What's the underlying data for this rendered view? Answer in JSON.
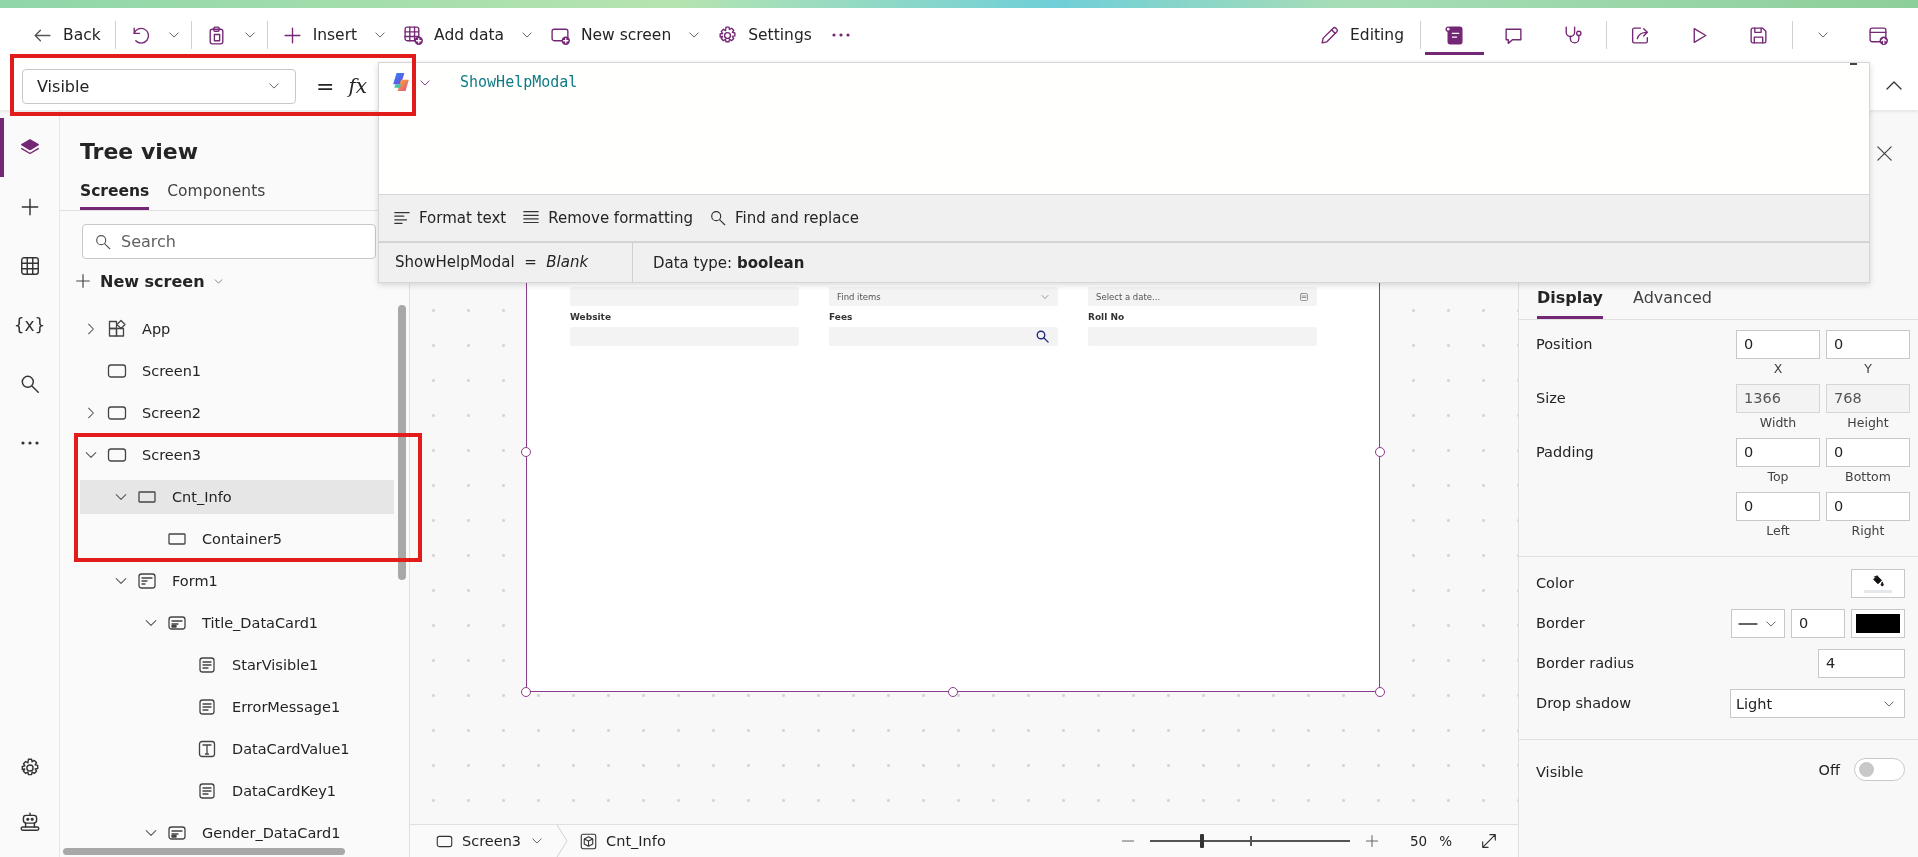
{
  "command_bar": {
    "left": [
      [
        {
          "kind": "back",
          "label": "Back",
          "menu": false
        }
      ],
      [
        {
          "kind": "undo",
          "menu": true
        }
      ],
      [
        {
          "kind": "paste",
          "menu": true
        }
      ],
      [
        {
          "kind": "plus",
          "label": "Insert",
          "menu": true
        },
        {
          "kind": "table-add",
          "label": "Add data",
          "menu": true
        },
        {
          "kind": "screen-add",
          "label": "New screen",
          "menu": true
        },
        {
          "kind": "gear",
          "label": "Settings",
          "menu": false
        },
        {
          "kind": "dots",
          "menu": false
        }
      ]
    ],
    "right": [
      [
        {
          "kind": "pencil",
          "label": "Editing",
          "selected": false
        }
      ],
      [
        {
          "kind": "notes",
          "selected": true
        },
        {
          "kind": "comment",
          "selected": false
        },
        {
          "kind": "stethoscope",
          "selected": false
        }
      ],
      [
        {
          "kind": "share",
          "selected": false
        },
        {
          "kind": "play",
          "selected": false
        },
        {
          "kind": "save",
          "selected": false
        }
      ],
      [
        {
          "kind": "caret",
          "selected": false
        },
        {
          "kind": "publish",
          "selected": false
        }
      ]
    ]
  },
  "formula_bar": {
    "property": "Visible",
    "equals": "=",
    "fx": "fx",
    "formula": "ShowHelpModal",
    "tools": [
      {
        "kind": "format",
        "label": "Format text"
      },
      {
        "kind": "lines",
        "label": "Remove formatting"
      },
      {
        "kind": "search",
        "label": "Find and replace"
      }
    ],
    "result": "ShowHelpModal  =  *Blank*",
    "data_type": "Data type: **boolean**"
  },
  "left_rail": {
    "top": [
      {
        "kind": "layers",
        "selected": true
      },
      {
        "kind": "plus",
        "selected": false
      },
      {
        "kind": "table",
        "selected": false
      },
      {
        "kind": "variables",
        "label": "{x}",
        "selected": false
      },
      {
        "kind": "search",
        "selected": false
      },
      {
        "kind": "dots",
        "selected": false
      }
    ],
    "bottom": [
      {
        "kind": "gear",
        "selected": false
      },
      {
        "kind": "bot",
        "selected": false
      }
    ]
  },
  "tree_view": {
    "title": "Tree view",
    "tabs": [
      {
        "label": "Screens",
        "selected": true
      },
      {
        "label": "Components",
        "selected": false
      }
    ],
    "search": {
      "placeholder": "Search"
    },
    "new_screen": "New screen",
    "items": [
      {
        "label": "App",
        "kind": "app",
        "expanded": false,
        "selected": false
      },
      {
        "label": "Screen1",
        "kind": "screen",
        "selected": false
      },
      {
        "label": "Screen2",
        "kind": "screen",
        "expanded": false,
        "selected": false
      },
      {
        "label": "Screen3",
        "kind": "screen",
        "expanded": true,
        "selected": false,
        "children": [
          {
            "label": "Cnt_Info",
            "kind": "container",
            "expanded": true,
            "selected": true,
            "children": [
              {
                "label": "Container5",
                "kind": "container",
                "selected": false
              }
            ]
          },
          {
            "label": "Form1",
            "kind": "form",
            "expanded": true,
            "selected": false,
            "children": [
              {
                "label": "Title_DataCard1",
                "kind": "card",
                "expanded": true,
                "selected": false,
                "children": [
                  {
                    "label": "StarVisible1",
                    "kind": "label",
                    "selected": false
                  },
                  {
                    "label": "ErrorMessage1",
                    "kind": "label",
                    "selected": false
                  },
                  {
                    "label": "DataCardValue1",
                    "kind": "text-input",
                    "selected": false
                  },
                  {
                    "label": "DataCardKey1",
                    "kind": "label",
                    "selected": false
                  }
                ]
              },
              {
                "label": "Gender_DataCard1",
                "kind": "card",
                "expanded": true,
                "selected": false
              }
            ]
          }
        ]
      }
    ]
  },
  "canvas": {
    "fields": [
      {
        "kind": "input"
      },
      {
        "kind": "dropdown",
        "placeholder": "Find items"
      },
      {
        "kind": "date",
        "placeholder": "Select a date..."
      },
      {
        "kind": "input",
        "label": "Website"
      },
      {
        "kind": "search",
        "label": "Fees"
      },
      {
        "kind": "input",
        "label": "Roll No"
      }
    ]
  },
  "bottom_bar": {
    "screen": "Screen3",
    "control": "Cnt_Info",
    "zoom": {
      "level": 0.26
    },
    "zoom_value": "50",
    "zoom_unit": "%"
  },
  "properties": {
    "tabs": [
      {
        "label": "Display",
        "selected": true
      },
      {
        "label": "Advanced",
        "selected": false
      }
    ],
    "sections": [
      {
        "rows": [
          {
            "kind": "pair",
            "label": "Position",
            "fields": [
              {
                "value": "0",
                "caption": "X",
                "disabled": false
              },
              {
                "value": "0",
                "caption": "Y",
                "disabled": false
              }
            ]
          },
          {
            "kind": "pair",
            "label": "Size",
            "fields": [
              {
                "value": "1366",
                "caption": "Width",
                "disabled": true
              },
              {
                "value": "768",
                "caption": "Height",
                "disabled": true
              }
            ]
          },
          {
            "kind": "pair",
            "label": "Padding",
            "fields": [
              {
                "value": "0",
                "caption": "Top",
                "disabled": false
              },
              {
                "value": "0",
                "caption": "Bottom",
                "disabled": false
              }
            ]
          },
          {
            "kind": "pair",
            "fields": [
              {
                "value": "0",
                "caption": "Left",
                "disabled": false
              },
              {
                "value": "0",
                "caption": "Right",
                "disabled": false
              }
            ]
          }
        ]
      },
      {
        "rows": [
          {
            "kind": "color",
            "label": "Color"
          },
          {
            "kind": "border",
            "label": "Border",
            "value": "0",
            "color": "#000000"
          },
          {
            "kind": "number",
            "label": "Border radius",
            "value": "4"
          },
          {
            "kind": "select",
            "label": "Drop shadow",
            "value": "Light"
          }
        ]
      },
      {
        "rows": [
          {
            "kind": "toggle",
            "label": "Visible",
            "on": false,
            "state": "Off"
          }
        ]
      }
    ]
  }
}
